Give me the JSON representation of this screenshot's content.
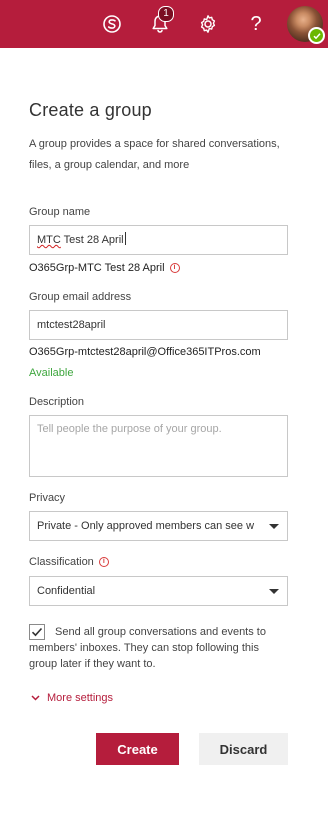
{
  "topbar": {
    "notification_count": "1",
    "colors": {
      "background": "#b51d3c",
      "badge": "#7a0e22",
      "presence": "#6bb700"
    },
    "icons": [
      "skype-icon",
      "bell-icon",
      "gear-icon",
      "help-icon",
      "avatar"
    ]
  },
  "form": {
    "title": "Create a group",
    "description": "A group provides a space for shared conversations, files, a group calendar, and more",
    "group_name": {
      "label": "Group name",
      "value_misspelled": "MTC",
      "value_rest": " Test 28 April",
      "hint": "O365Grp-MTC Test 28 April"
    },
    "group_email": {
      "label": "Group email address",
      "value": "mtctest28april",
      "full_address": "O365Grp-mtctest28april@Office365ITPros.com",
      "status": "Available"
    },
    "description_field": {
      "label": "Description",
      "placeholder": "Tell people the purpose of your group."
    },
    "privacy": {
      "label": "Privacy",
      "selected": "Private - Only approved members can see w"
    },
    "classification": {
      "label": "Classification",
      "selected": "Confidential"
    },
    "subscribe": {
      "checked": true,
      "label": "Send all group conversations and events to members' inboxes. They can stop following this group later if they want to."
    },
    "more_settings": "More settings",
    "create_label": "Create",
    "discard_label": "Discard"
  }
}
